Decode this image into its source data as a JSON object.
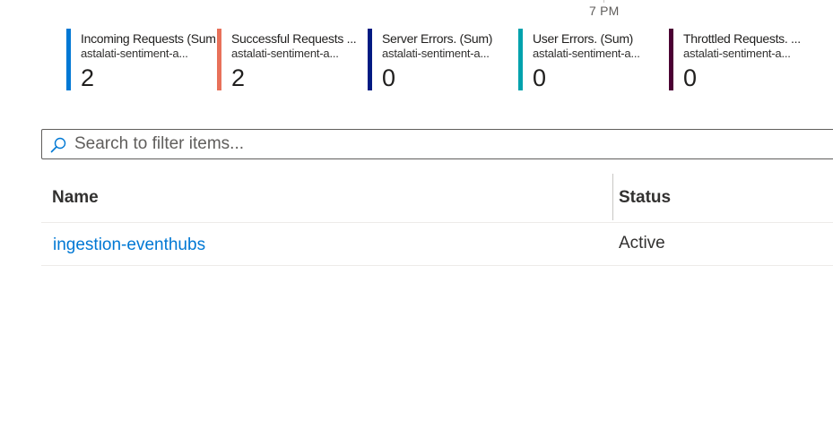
{
  "chart": {
    "time_label": "7 PM"
  },
  "metrics": [
    {
      "name": "Incoming Requests (Sum)",
      "resource": "astalati-sentiment-a...",
      "value": "2",
      "color": "#0078d4"
    },
    {
      "name": "Successful Requests ...",
      "resource": "astalati-sentiment-a...",
      "value": "2",
      "color": "#e8715a"
    },
    {
      "name": "Server Errors. (Sum)",
      "resource": "astalati-sentiment-a...",
      "value": "0",
      "color": "#001a82"
    },
    {
      "name": "User Errors. (Sum)",
      "resource": "astalati-sentiment-a...",
      "value": "0",
      "color": "#00a2ad"
    },
    {
      "name": "Throttled Requests. ...",
      "resource": "astalati-sentiment-a...",
      "value": "0",
      "color": "#4b0033"
    }
  ],
  "search": {
    "placeholder": "Search to filter items...",
    "value": ""
  },
  "grid": {
    "columns": {
      "name": "Name",
      "status": "Status"
    },
    "rows": [
      {
        "name": "ingestion-eventhubs",
        "status": "Active"
      }
    ]
  }
}
